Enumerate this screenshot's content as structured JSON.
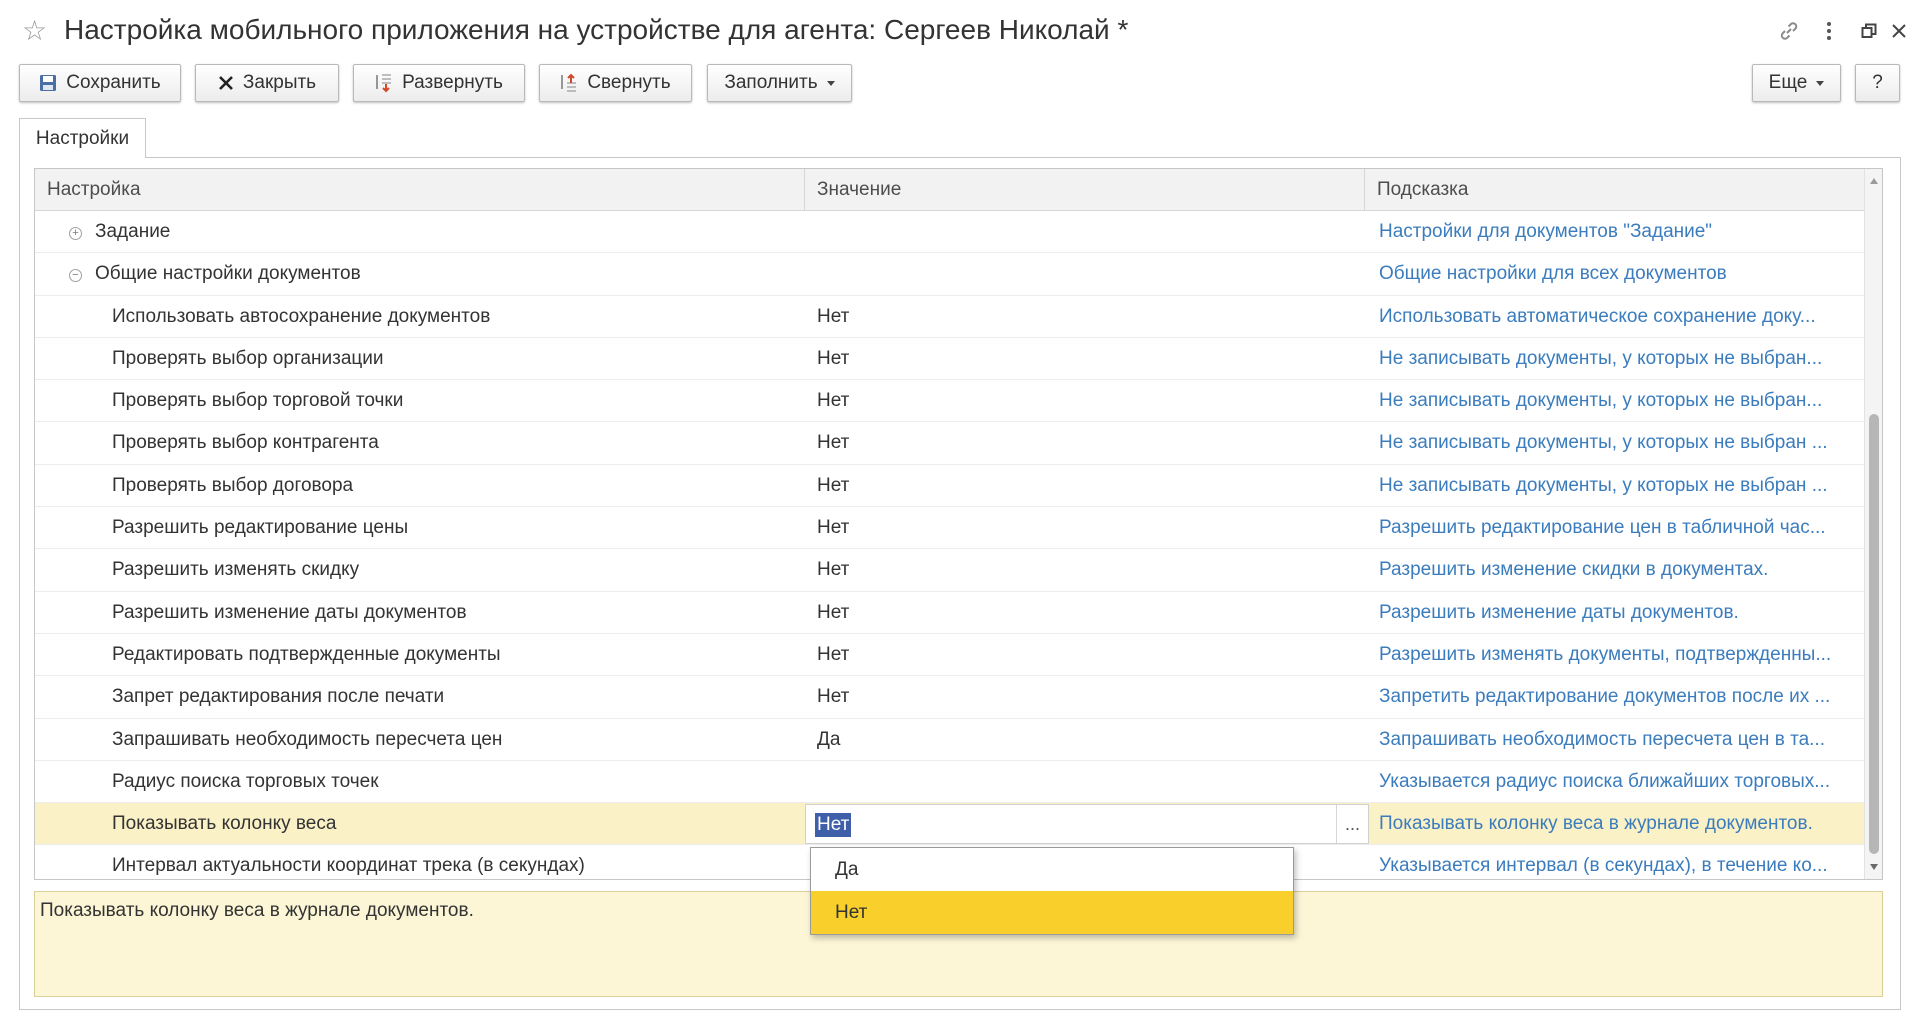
{
  "window": {
    "title": "Настройка мобильного приложения на устройстве для агента: Сергеев Николай *"
  },
  "toolbar": {
    "save": "Сохранить",
    "close": "Закрыть",
    "expand": "Развернуть",
    "collapse": "Свернуть",
    "fill": "Заполнить",
    "more": "Еще",
    "help": "?"
  },
  "tabs": [
    "Настройки"
  ],
  "table": {
    "columns": {
      "setting": "Настройка",
      "value": "Значение",
      "hint": "Подсказка"
    },
    "rows": [
      {
        "name": "Задание",
        "value": "",
        "hint": "Настройки для документов \"Задание\"",
        "level": 0,
        "group": "collapsed"
      },
      {
        "name": "Общие настройки документов",
        "value": "",
        "hint": "Общие настройки для всех документов",
        "level": 0,
        "group": "expanded"
      },
      {
        "name": "Использовать автосохранение документов",
        "value": "Нет",
        "hint": "Использовать автоматическое сохранение доку...",
        "level": 1
      },
      {
        "name": "Проверять выбор организации",
        "value": "Нет",
        "hint": "Не записывать документы, у которых не выбран...",
        "level": 1
      },
      {
        "name": "Проверять выбор торговой точки",
        "value": "Нет",
        "hint": "Не записывать документы, у которых не выбран...",
        "level": 1
      },
      {
        "name": "Проверять выбор контрагента",
        "value": "Нет",
        "hint": "Не записывать документы, у которых не выбран ...",
        "level": 1
      },
      {
        "name": "Проверять выбор договора",
        "value": "Нет",
        "hint": "Не записывать документы, у которых не выбран ...",
        "level": 1
      },
      {
        "name": "Разрешить редактирование цены",
        "value": "Нет",
        "hint": "Разрешить редактирование цен в табличной час...",
        "level": 1
      },
      {
        "name": "Разрешить изменять скидку",
        "value": "Нет",
        "hint": "Разрешить изменение скидки в документах.",
        "level": 1
      },
      {
        "name": "Разрешить изменение даты документов",
        "value": "Нет",
        "hint": "Разрешить изменение даты документов.",
        "level": 1
      },
      {
        "name": "Редактировать подтвержденные документы",
        "value": "Нет",
        "hint": "Разрешить изменять документы, подтвержденны...",
        "level": 1
      },
      {
        "name": "Запрет редактирования после печати",
        "value": "Нет",
        "hint": "Запретить редактирование документов после их ...",
        "level": 1
      },
      {
        "name": "Запрашивать необходимость пересчета цен",
        "value": "Да",
        "hint": "Запрашивать необходимость пересчета цен в та...",
        "level": 1
      },
      {
        "name": "Радиус поиска торговых точек",
        "value": "",
        "hint": "Указывается радиус поиска ближайших торговых...",
        "level": 1
      },
      {
        "name": "Показывать колонку веса",
        "value": "Нет",
        "hint": "Показывать колонку веса в журнале документов.",
        "level": 1,
        "selected": true
      },
      {
        "name": "Интервал актуальности координат трека (в секундах)",
        "value": "",
        "hint": "Указывается интервал (в секундах), в течение ко...",
        "level": 1
      }
    ]
  },
  "editor": {
    "value": "Нет",
    "choice_button": "..."
  },
  "dropdown": {
    "options": [
      "Да",
      "Нет"
    ],
    "highlighted": "Нет"
  },
  "hint_box": {
    "text": "Показывать колонку веса в журнале документов."
  },
  "colors": {
    "link": "#3b7cbd",
    "selected_row": "#fbf1c7",
    "dropdown_highlight": "#f9cf2c",
    "text_selection": "#3f5fa9",
    "hint_box": "#fcf6d6"
  },
  "icons": {
    "favorite": "star-icon",
    "link": "link-icon",
    "menu": "more-vertical-icon",
    "restore": "window-restore-icon",
    "close": "close-icon",
    "save": "floppy-disk-icon",
    "close_form": "cross-icon",
    "expand": "expand-tree-icon",
    "collapse": "collapse-tree-icon",
    "group_collapsed": "plus-circle-icon",
    "group_expanded": "minus-circle-icon"
  }
}
